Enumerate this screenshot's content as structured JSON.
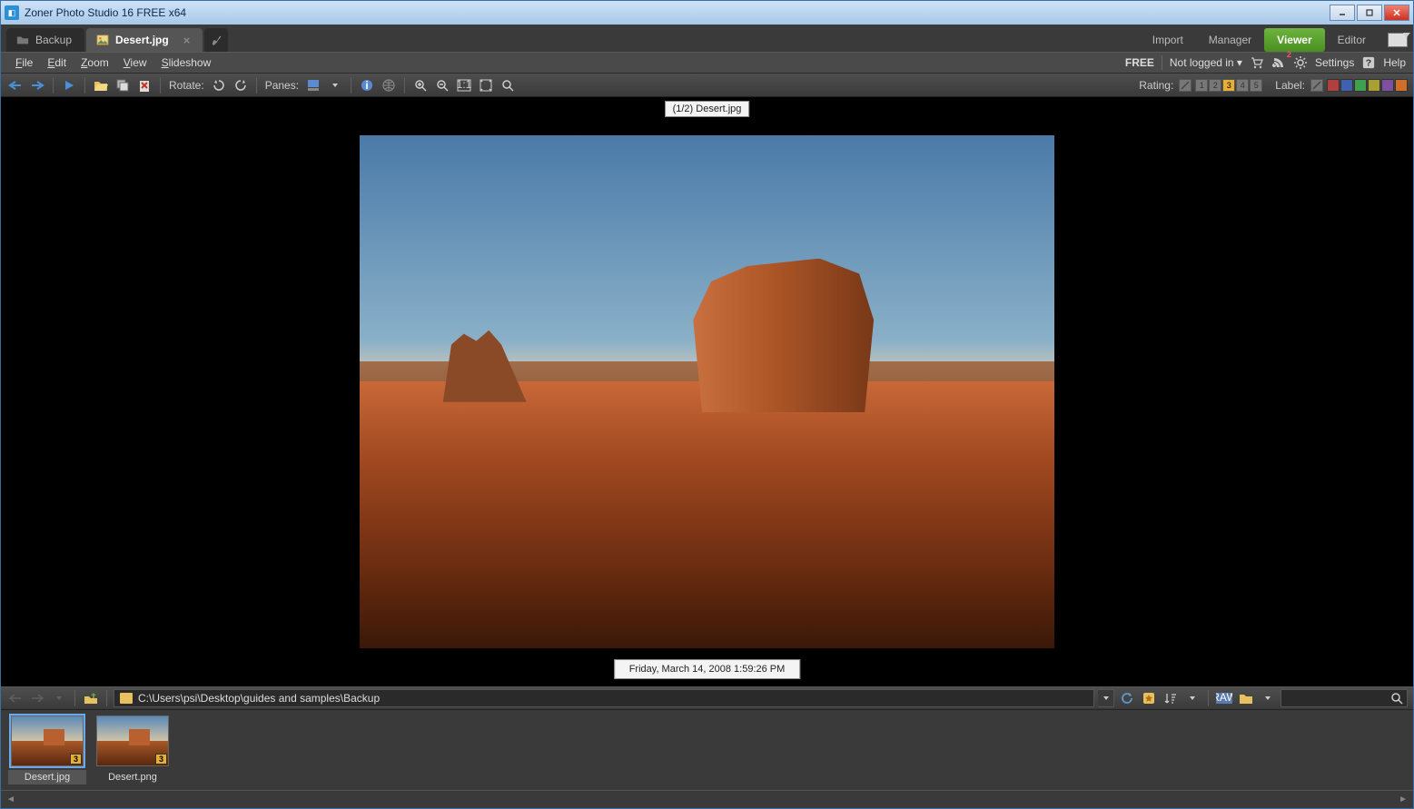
{
  "window": {
    "title": "Zoner Photo Studio 16 FREE x64"
  },
  "tabs": [
    {
      "label": "Backup",
      "active": false
    },
    {
      "label": "Desert.jpg",
      "active": true
    }
  ],
  "modes": {
    "import": "Import",
    "manager": "Manager",
    "viewer": "Viewer",
    "editor": "Editor"
  },
  "menu": {
    "file": "File",
    "edit": "Edit",
    "zoom": "Zoom",
    "view": "View",
    "slideshow": "Slideshow"
  },
  "account": {
    "free": "FREE",
    "login": "Not logged in",
    "rss_count": "2",
    "settings": "Settings",
    "help": "Help"
  },
  "toolbar": {
    "rotate": "Rotate:",
    "panes": "Panes:",
    "rating_label": "Rating:",
    "ratings": [
      "1",
      "2",
      "3",
      "4",
      "5"
    ],
    "rating_selected": 3,
    "label_label": "Label:",
    "label_colors": [
      "#b04040",
      "#4060b0",
      "#40a050",
      "#a8a030",
      "#8050a0",
      "#d07028"
    ]
  },
  "viewer": {
    "counter": "(1/2) Desert.jpg",
    "timestamp": "Friday, March 14, 2008 1:59:26 PM"
  },
  "path": "C:\\Users\\psi\\Desktop\\guides and samples\\Backup",
  "thumbs": [
    {
      "name": "Desert.jpg",
      "rating": "3",
      "selected": true
    },
    {
      "name": "Desert.png",
      "rating": "3",
      "selected": false
    }
  ]
}
